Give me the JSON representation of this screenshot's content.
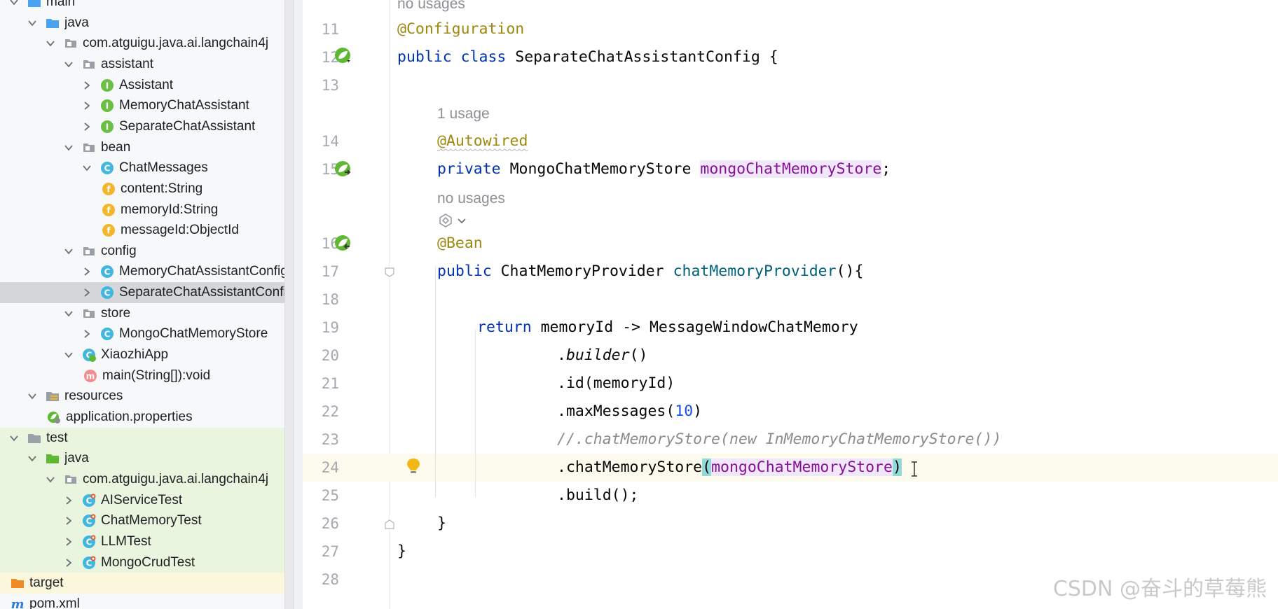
{
  "project_tree": {
    "items": [
      {
        "label": "main",
        "icon": "folder-source-icon",
        "chevron": "expanded"
      },
      {
        "label": "java",
        "icon": "folder-source-icon",
        "chevron": "expanded"
      },
      {
        "label": "com.atguigu.java.ai.langchain4j",
        "icon": "package-icon",
        "chevron": "expanded"
      },
      {
        "label": "assistant",
        "icon": "package-icon",
        "chevron": "expanded"
      },
      {
        "label": "Assistant",
        "icon": "interface-icon",
        "chevron": "collapsed"
      },
      {
        "label": "MemoryChatAssistant",
        "icon": "interface-icon",
        "chevron": "collapsed"
      },
      {
        "label": "SeparateChatAssistant",
        "icon": "interface-icon",
        "chevron": "collapsed"
      },
      {
        "label": "bean",
        "icon": "package-icon",
        "chevron": "expanded"
      },
      {
        "label": "ChatMessages",
        "icon": "class-icon",
        "chevron": "expanded"
      },
      {
        "label": "content:String",
        "icon": "field-icon",
        "chevron": "none"
      },
      {
        "label": "memoryId:String",
        "icon": "field-icon",
        "chevron": "none"
      },
      {
        "label": "messageId:ObjectId",
        "icon": "field-icon",
        "chevron": "none"
      },
      {
        "label": "config",
        "icon": "package-icon",
        "chevron": "expanded"
      },
      {
        "label": "MemoryChatAssistantConfig",
        "icon": "class-icon",
        "chevron": "collapsed"
      },
      {
        "label": "SeparateChatAssistantConfig",
        "icon": "class-icon",
        "chevron": "collapsed"
      },
      {
        "label": "store",
        "icon": "package-icon",
        "chevron": "expanded"
      },
      {
        "label": "MongoChatMemoryStore",
        "icon": "class-icon",
        "chevron": "collapsed"
      },
      {
        "label": "XiaozhiApp",
        "icon": "spring-class-icon",
        "chevron": "expanded"
      },
      {
        "label": "main(String[]):void",
        "icon": "method-icon",
        "chevron": "none"
      },
      {
        "label": "resources",
        "icon": "folder-resources-icon",
        "chevron": "expanded"
      },
      {
        "label": "application.properties",
        "icon": "spring-properties-icon",
        "chevron": "none"
      },
      {
        "label": "test",
        "icon": "folder-plain-icon",
        "chevron": "expanded"
      },
      {
        "label": "java",
        "icon": "folder-test-icon",
        "chevron": "expanded"
      },
      {
        "label": "com.atguigu.java.ai.langchain4j",
        "icon": "package-icon",
        "chevron": "expanded"
      },
      {
        "label": "AIServiceTest",
        "icon": "test-class-icon",
        "chevron": "collapsed"
      },
      {
        "label": "ChatMemoryTest",
        "icon": "test-class-icon",
        "chevron": "collapsed"
      },
      {
        "label": "LLMTest",
        "icon": "test-class-icon",
        "chevron": "collapsed"
      },
      {
        "label": "MongoCrudTest",
        "icon": "test-class-icon",
        "chevron": "collapsed"
      },
      {
        "label": "target",
        "icon": "folder-excluded-icon",
        "chevron": "none"
      },
      {
        "label": "pom.xml",
        "icon": "maven-icon",
        "chevron": "none"
      }
    ],
    "selected": "SeparateChatAssistantConfig"
  },
  "editor": {
    "line_numbers": [
      "11",
      "12",
      "13",
      "14",
      "15",
      "16",
      "17",
      "18",
      "19",
      "20",
      "21",
      "22",
      "23",
      "24",
      "25",
      "26",
      "27",
      "28"
    ],
    "hints": {
      "top": "no usages",
      "field_usages": "1 usage",
      "method_usages": "no usages"
    },
    "code": {
      "l11": "@Configuration",
      "l12_kw": "public class ",
      "l12_name": "SeparateChatAssistantConfig {",
      "l14": "@Autowired",
      "l15_kw": "private ",
      "l15_type": "MongoChatMemoryStore ",
      "l15_field": "mongoChatMemoryStore",
      "l15_end": ";",
      "l16": "@Bean",
      "l17_kw": "public ",
      "l17_type": "ChatMemoryProvider ",
      "l17_method": "chatMemoryProvider",
      "l17_end": "(){",
      "l19_kw": "return ",
      "l19_rest": "memoryId -> MessageWindowChatMemory",
      "l20_dot": ".",
      "l20_call": "builder",
      "l20_end": "()",
      "l21": ".id(memoryId)",
      "l22_a": ".maxMessages(",
      "l22_num": "10",
      "l22_b": ")",
      "l23": "//.chatMemoryStore(new InMemoryChatMemoryStore())",
      "l24_a": ".chatMemoryStore",
      "l24_open": "(",
      "l24_field": "mongoChatMemoryStore",
      "l24_close": ")",
      "l25": ".build();",
      "l26": "}",
      "l27": "}"
    },
    "colors": {
      "annotation": "#9e880d",
      "keyword": "#0033b3",
      "method": "#00627a",
      "field": "#871094",
      "number": "#1750eb",
      "comment": "#8c8c8c"
    }
  },
  "watermark": "CSDN @奋斗的草莓熊"
}
